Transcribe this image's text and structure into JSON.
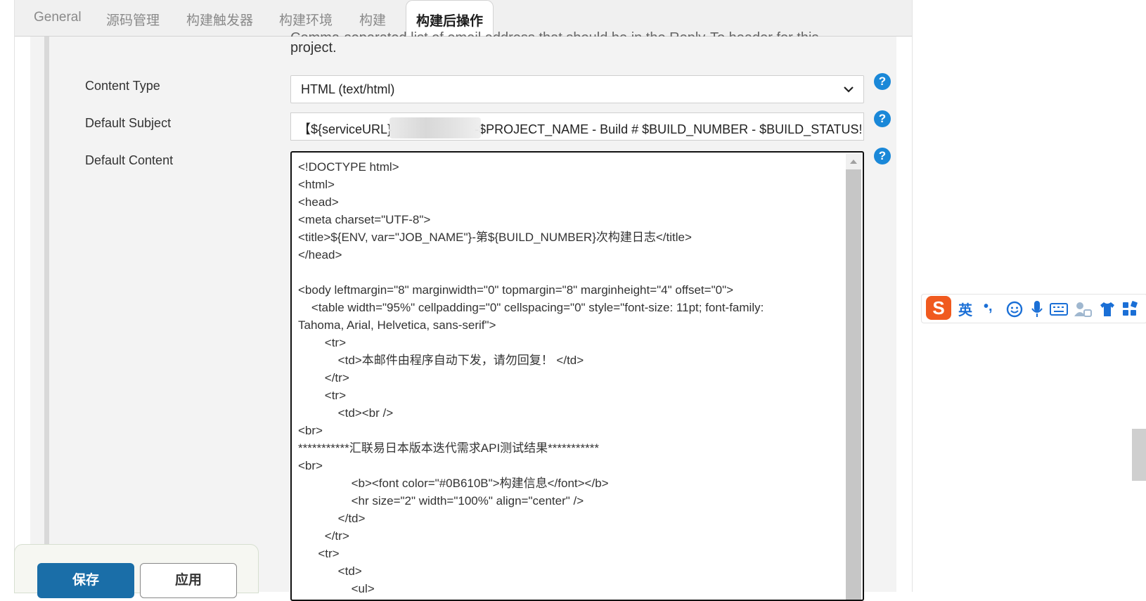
{
  "tabs": [
    {
      "label": "General",
      "active": false
    },
    {
      "label": "源码管理",
      "active": false
    },
    {
      "label": "构建触发器",
      "active": false
    },
    {
      "label": "构建环境",
      "active": false
    },
    {
      "label": "构建",
      "active": false
    },
    {
      "label": "构建后操作",
      "active": true
    }
  ],
  "reply_to_description": {
    "line1_partial": "Comma-separated list of email address that should be in the Reply-To header for this",
    "line2": "project."
  },
  "content_type": {
    "label": "Content Type",
    "value": "HTML (text/html)"
  },
  "default_subject": {
    "label": "Default Subject",
    "value_prefix": "【${serviceURL}",
    "value_suffix": "-$PROJECT_NAME - Build # $BUILD_NUMBER - $BUILD_STATUS!"
  },
  "default_content": {
    "label": "Default Content",
    "lines": [
      "<!DOCTYPE html>",
      "<html>",
      "<head>",
      "<meta charset=\"UTF-8\">",
      "<title>${ENV, var=\"JOB_NAME\"}-第${BUILD_NUMBER}次构建日志</title>",
      "</head>",
      "",
      "<body leftmargin=\"8\" marginwidth=\"0\" topmargin=\"8\" marginheight=\"4\" offset=\"0\">",
      "    <table width=\"95%\" cellpadding=\"0\" cellspacing=\"0\" style=\"font-size: 11pt; font-family:",
      "Tahoma, Arial, Helvetica, sans-serif\">",
      "        <tr>",
      "            <td>本邮件由程序自动下发，请勿回复！ </td>",
      "        </tr>",
      "        <tr>",
      "            <td><br />",
      "<br>",
      "***********汇联易日本版本迭代需求API测试结果***********",
      "<br>",
      "                <b><font color=\"#0B610B\">构建信息</font></b>",
      "                <hr size=\"2\" width=\"100%\" align=\"center\" />",
      "            </td>",
      "        </tr>",
      "      <tr>",
      "            <td>",
      "                <ul>"
    ]
  },
  "help_icon_glyph": "?",
  "buttons": {
    "save": "保存",
    "apply": "应用"
  },
  "ime_toolbar": {
    "logo": "S",
    "lang": "英",
    "punct": "•,"
  },
  "colors": {
    "primary_button": "#1a6ea8",
    "help_icon": "#1a88d8",
    "ime_logo": "#f05a1f"
  }
}
